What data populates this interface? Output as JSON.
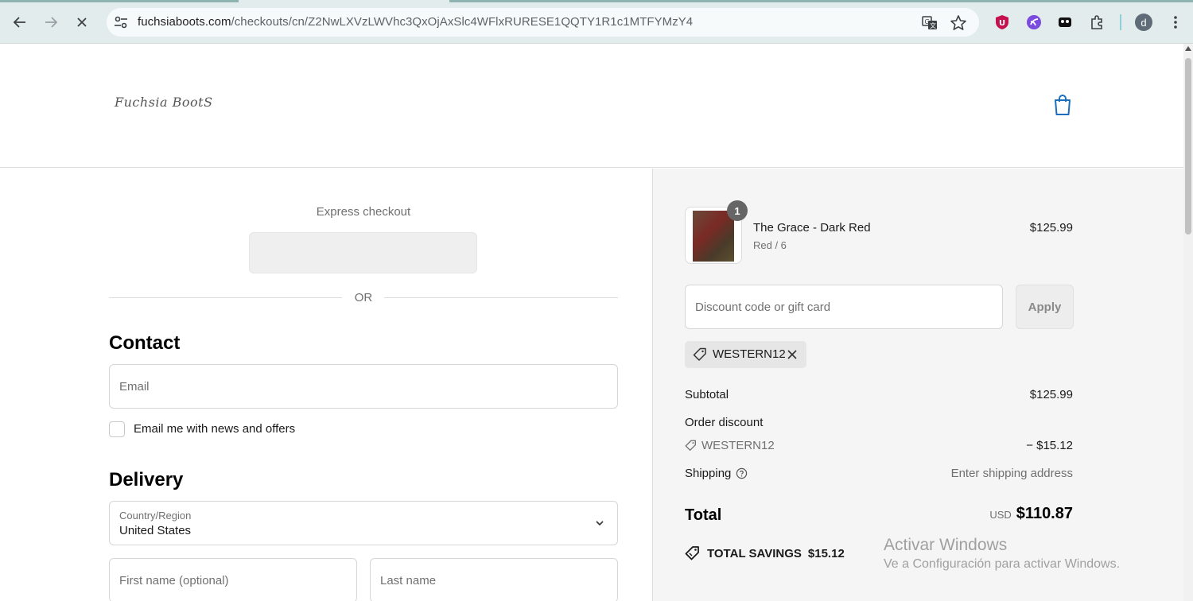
{
  "browser": {
    "url_host": "fuchsiaboots.com",
    "url_path": "/checkouts/cn/Z2NwLXVzLWVhc3QxOjAxSlc4WFlxRURESE1QQTY1R1c1MTFYMzY4",
    "profile_initial": "d"
  },
  "header": {
    "logo_text": "Fuchsia BootS"
  },
  "express": {
    "title": "Express checkout",
    "or_label": "OR"
  },
  "contact": {
    "heading": "Contact",
    "email_placeholder": "Email",
    "newsletter_label": "Email me with news and offers"
  },
  "delivery": {
    "heading": "Delivery",
    "country_label": "Country/Region",
    "country_value": "United States",
    "first_name_placeholder": "First name (optional)",
    "last_name_placeholder": "Last name"
  },
  "summary": {
    "product": {
      "quantity": "1",
      "name": "The Grace - Dark Red",
      "variant": "Red / 6",
      "price": "$125.99"
    },
    "discount_placeholder": "Discount code or gift card",
    "apply_label": "Apply",
    "applied_code": "WESTERN12",
    "subtotal_label": "Subtotal",
    "subtotal_value": "$125.99",
    "order_discount_label": "Order discount",
    "discount_code": "WESTERN12",
    "discount_value": "− $15.12",
    "shipping_label": "Shipping",
    "shipping_value": "Enter shipping address",
    "total_label": "Total",
    "currency": "USD",
    "total_value": "$110.87",
    "savings_label": "TOTAL SAVINGS",
    "savings_value": "$15.12"
  },
  "watermark": {
    "line1": "Activar Windows",
    "line2": "Ve a Configuración para activar Windows."
  }
}
